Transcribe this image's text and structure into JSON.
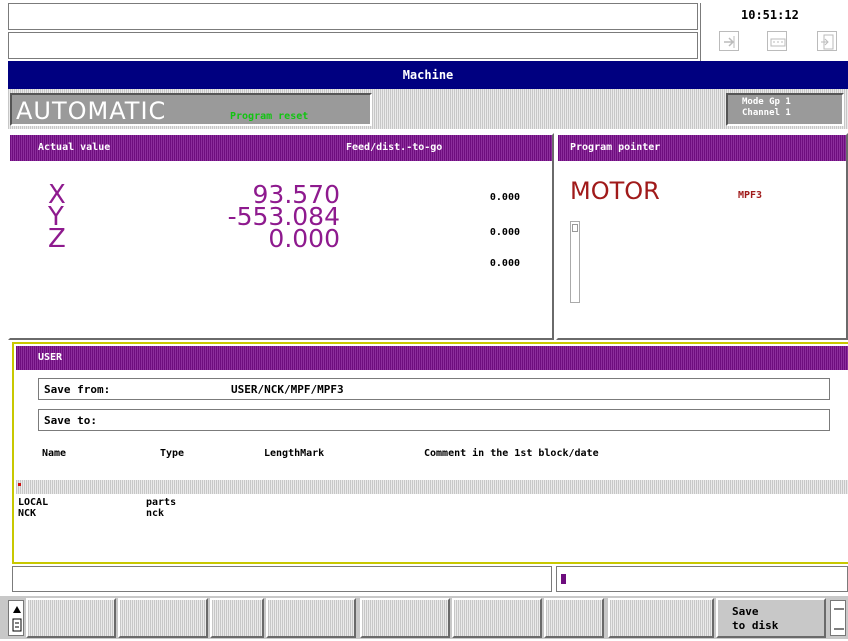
{
  "header": {
    "time": "10:51:12",
    "title": "Machine",
    "icons": [
      "enter-arrow-icon",
      "keyboard-icon",
      "exit-door-icon"
    ]
  },
  "mode": {
    "name": "AUTOMATIC",
    "status": "Program reset",
    "group_line1": "Mode Gp 1",
    "group_line2": "Channel 1"
  },
  "actual": {
    "title": "Actual value",
    "feed_title": "Feed/dist.-to-go",
    "axes": [
      {
        "name": "X",
        "value": "93.570",
        "feed": "0.000"
      },
      {
        "name": "Y",
        "value": "-553.084",
        "feed": "0.000"
      },
      {
        "name": "Z",
        "value": "0.000",
        "feed": "0.000"
      }
    ]
  },
  "program": {
    "title": "Program pointer",
    "name": "MOTOR",
    "file": "MPF3"
  },
  "user": {
    "title": "USER",
    "save_from_label": "Save from:",
    "save_from_value": "USER/NCK/MPF/MPF3",
    "save_to_label": "Save to:",
    "columns": [
      "Name",
      "Type",
      "LengthMark",
      "Comment in the 1st block/date"
    ],
    "rows": [
      {
        "name": "LOCAL",
        "type": "parts"
      },
      {
        "name": "NCK",
        "type": "nck"
      }
    ]
  },
  "softkeys": {
    "save_line1": "Save",
    "save_line2": "to disk"
  },
  "colors": {
    "header_blue": "#000080",
    "purple": "#6e0d7e",
    "axis_text": "#8e1a8e",
    "program_text": "#a01a1a",
    "status_green": "#11c411",
    "focus_border": "#c8c800"
  }
}
